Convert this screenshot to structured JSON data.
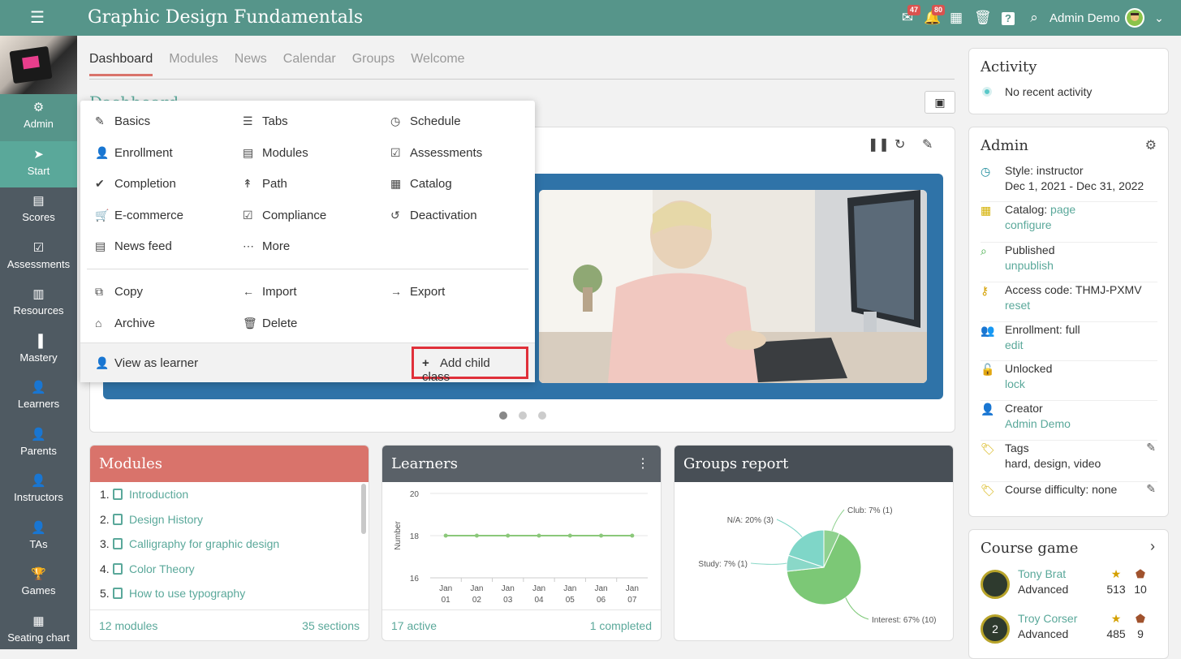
{
  "header": {
    "title": "Graphic Design Fundamentals",
    "messages_badge": "47",
    "notifications_badge": "80",
    "user": "Admin Demo"
  },
  "sidebar": {
    "items": [
      {
        "label": "Admin",
        "icon": "gear-icon"
      },
      {
        "label": "Start",
        "icon": "navigation-arrow-icon"
      },
      {
        "label": "Scores",
        "icon": "scores-icon"
      },
      {
        "label": "Assessments",
        "icon": "checkbox-icon"
      },
      {
        "label": "Resources",
        "icon": "resources-icon"
      },
      {
        "label": "Mastery",
        "icon": "bar-chart-icon"
      },
      {
        "label": "Learners",
        "icon": "person-icon"
      },
      {
        "label": "Parents",
        "icon": "person-icon"
      },
      {
        "label": "Instructors",
        "icon": "person-icon"
      },
      {
        "label": "TAs",
        "icon": "person-icon"
      },
      {
        "label": "Games",
        "icon": "trophy-icon"
      },
      {
        "label": "Seating chart",
        "icon": "grid-icon"
      }
    ]
  },
  "tabs": [
    "Dashboard",
    "Modules",
    "News",
    "Calendar",
    "Groups",
    "Welcome"
  ],
  "dashboard_title": "Dashboard",
  "admin_menu": {
    "items": [
      {
        "label": "Basics",
        "icon": "pencil-icon"
      },
      {
        "label": "Tabs",
        "icon": "list-icon"
      },
      {
        "label": "Schedule",
        "icon": "clock-icon"
      },
      {
        "label": "Enrollment",
        "icon": "person-icon"
      },
      {
        "label": "Modules",
        "icon": "book-icon"
      },
      {
        "label": "Assessments",
        "icon": "checkbox-icon"
      },
      {
        "label": "Completion",
        "icon": "check-icon"
      },
      {
        "label": "Path",
        "icon": "signpost-icon"
      },
      {
        "label": "Catalog",
        "icon": "grid-icon"
      },
      {
        "label": "E-commerce",
        "icon": "cart-icon"
      },
      {
        "label": "Compliance",
        "icon": "clipboard-check-icon"
      },
      {
        "label": "Deactivation",
        "icon": "undo-icon"
      },
      {
        "label": "News feed",
        "icon": "newspaper-icon"
      },
      {
        "label": "More",
        "icon": "ellipsis-icon"
      }
    ],
    "actions": [
      {
        "label": "Copy",
        "icon": "copy-icon"
      },
      {
        "label": "Import",
        "icon": "arrow-left-icon"
      },
      {
        "label": "Export",
        "icon": "arrow-right-icon"
      },
      {
        "label": "Archive",
        "icon": "archive-icon"
      },
      {
        "label": "Delete",
        "icon": "trash-icon"
      }
    ],
    "view_as_learner": "View as learner",
    "add_child_class": "Add child class"
  },
  "modules_panel": {
    "title": "Modules",
    "items": [
      "Introduction",
      "Design History",
      "Calligraphy for graphic design",
      "Color Theory",
      "How to use typography"
    ],
    "footer_left": "12 modules",
    "footer_right": "35 sections"
  },
  "learners_panel": {
    "title": "Learners",
    "footer_left": "17 active",
    "footer_right": "1 completed"
  },
  "groups_panel": {
    "title": "Groups report"
  },
  "chart_data": [
    {
      "type": "line",
      "ylabel": "Number",
      "ylim": [
        16,
        20
      ],
      "yticks": [
        "20",
        "18",
        "16"
      ],
      "x": [
        "Jan 01",
        "Jan 02",
        "Jan 03",
        "Jan 04",
        "Jan 05",
        "Jan 06",
        "Jan 07"
      ],
      "values": [
        18,
        18,
        18,
        18,
        18,
        18,
        18
      ]
    },
    {
      "type": "pie",
      "slices": [
        {
          "label": "Club: 7% (1)",
          "value": 7
        },
        {
          "label": "Interest: 67% (10)",
          "value": 67
        },
        {
          "label": "Study: 7% (1)",
          "value": 7
        },
        {
          "label": "N/A: 20% (3)",
          "value": 20
        }
      ]
    }
  ],
  "activity": {
    "title": "Activity",
    "text": "No recent activity"
  },
  "admin_card": {
    "title": "Admin",
    "rows": [
      {
        "icon": "clock-icon",
        "text": "Style: instructor",
        "sub": "Dec 1, 2021 - Dec 31, 2022",
        "sub_link": false
      },
      {
        "icon": "catalog-icon",
        "text": "Catalog:",
        "link": "page",
        "sub": "configure",
        "sub_link": true
      },
      {
        "icon": "search-icon",
        "text": "Published",
        "sub": "unpublish",
        "sub_link": true
      },
      {
        "icon": "key-icon",
        "text": "Access code: THMJ-PXMV",
        "sub": "reset",
        "sub_link": true
      },
      {
        "icon": "group-icon",
        "text": "Enrollment: full",
        "sub": "edit",
        "sub_link": true
      },
      {
        "icon": "unlock-icon",
        "text": "Unlocked",
        "sub": "lock",
        "sub_link": true
      },
      {
        "icon": "person-icon",
        "text": "Creator",
        "sub": "Admin Demo",
        "sub_link": true
      },
      {
        "icon": "tag-icon",
        "text": "Tags",
        "sub": "hard, design, video",
        "sub_link": false
      },
      {
        "icon": "tag-icon",
        "text": "Course difficulty: none",
        "sub": "",
        "sub_link": false
      }
    ]
  },
  "course_game": {
    "title": "Course game",
    "players": [
      {
        "name": "Tony Brat",
        "level": "Advanced",
        "points": "513",
        "badges": "10"
      },
      {
        "name": "Troy Corser",
        "level": "Advanced",
        "points": "485",
        "badges": "9",
        "avatar_text": "2"
      }
    ]
  },
  "colors": {
    "teal": "#56958a",
    "modules_header": "#d9736b",
    "learners_header": "#5a6168",
    "groups_header": "#484f56",
    "carousel_bg": "#2f73a8",
    "link": "#5aa89a",
    "highlight": "#e0303a"
  }
}
